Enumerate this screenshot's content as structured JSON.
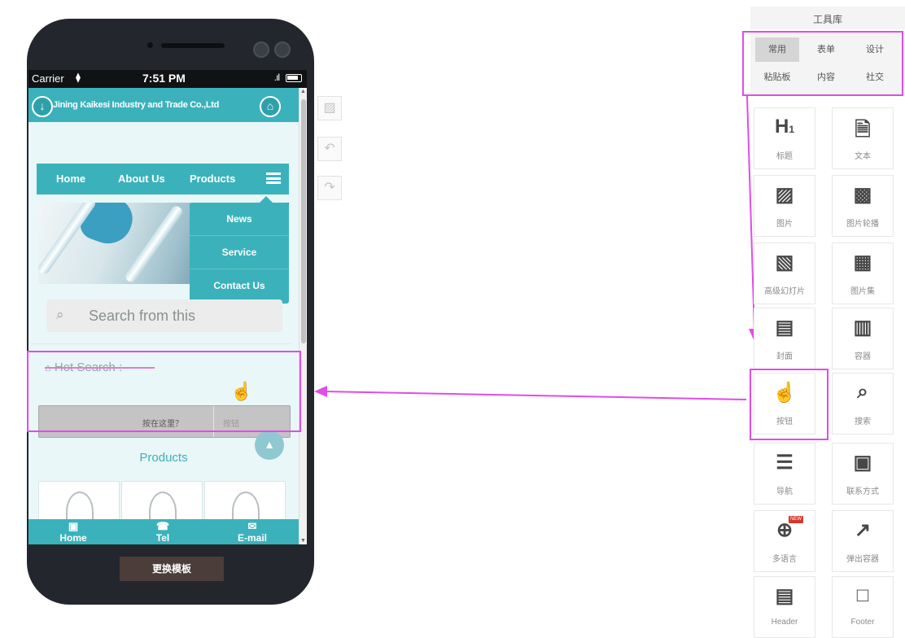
{
  "phone": {
    "status": {
      "carrier": "Carrier",
      "time": "7:51 PM"
    },
    "site_title": "Jining Kaikesi Industry and Trade Co.,Ltd",
    "nav": {
      "items": [
        "Home",
        "About Us",
        "Products"
      ]
    },
    "dropdown": [
      "News",
      "Service",
      "Contact Us"
    ],
    "search_placeholder": "Search from this",
    "hot_search": "Hot Search :",
    "button_row": {
      "label": "按在这里？",
      "sublabel": "按钮"
    },
    "products_title": "Products",
    "footer": [
      {
        "icon": "home-icon",
        "label": "Home"
      },
      {
        "icon": "phone-icon",
        "label": "Tel"
      },
      {
        "icon": "email-icon",
        "label": "E-mail"
      }
    ],
    "change_template": "更换模板"
  },
  "toolbox": {
    "title": "工具库",
    "tabs": [
      "常用",
      "表单",
      "设计",
      "粘贴板",
      "内容",
      "社交"
    ],
    "active_tab": "常用",
    "tiles": [
      {
        "icon": "heading-icon",
        "label": "标题"
      },
      {
        "icon": "text-icon",
        "label": "文本"
      },
      {
        "icon": "image-icon",
        "label": "图片"
      },
      {
        "icon": "image-carousel-icon",
        "label": "图片轮播"
      },
      {
        "icon": "slideshow-icon",
        "label": "高级幻灯片"
      },
      {
        "icon": "gallery-icon",
        "label": "图片集"
      },
      {
        "icon": "cover-icon",
        "label": "封面"
      },
      {
        "icon": "container-icon",
        "label": "容器"
      },
      {
        "icon": "button-icon",
        "label": "按钮"
      },
      {
        "icon": "search-icon",
        "label": "搜索"
      },
      {
        "icon": "navigation-icon",
        "label": "导航"
      },
      {
        "icon": "contact-icon",
        "label": "联系方式"
      },
      {
        "icon": "language-icon",
        "label": "多语言"
      },
      {
        "icon": "popup-icon",
        "label": "弹出容器"
      },
      {
        "icon": "header-icon",
        "label": "Header"
      },
      {
        "icon": "footer-icon",
        "label": "Footer"
      }
    ]
  },
  "colors": {
    "accent": "#3bb2bb",
    "highlight": "#e14ce8",
    "phone_body": "#23272d"
  }
}
